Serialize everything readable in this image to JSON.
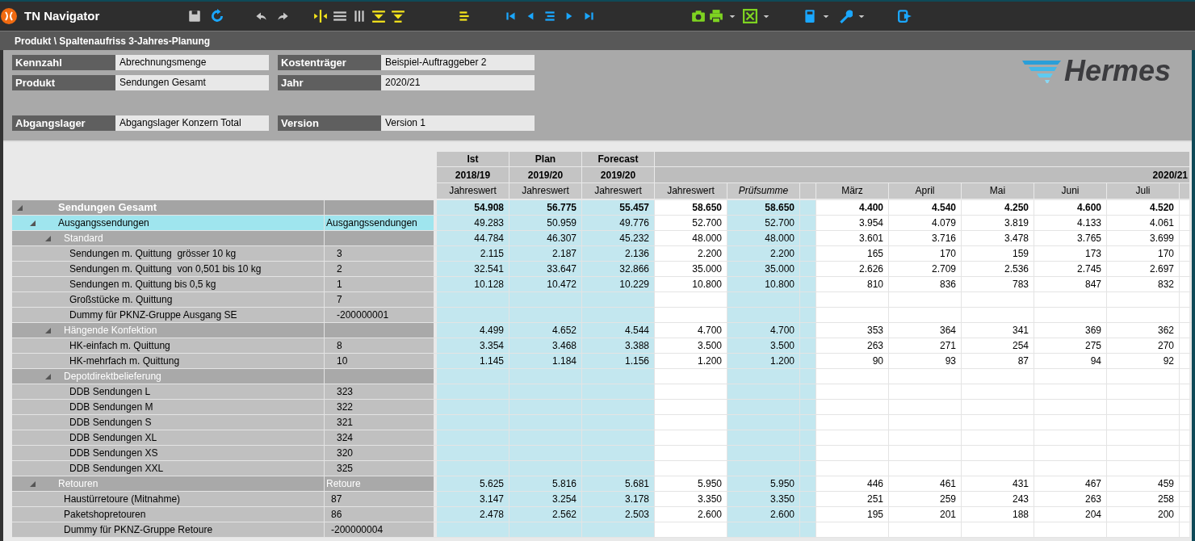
{
  "app": {
    "title": "TN Navigator"
  },
  "breadcrumb": "Produkt \\ Spaltenaufriss 3-Jahres-Planung",
  "filters": [
    [
      {
        "label": "Kennzahl",
        "value": "Abrechnungsmenge"
      },
      {
        "label": "Kostenträger",
        "value": "Beispiel-Auftraggeber 2"
      }
    ],
    [
      {
        "label": "Produkt",
        "value": "Sendungen Gesamt"
      },
      {
        "label": "Jahr",
        "value": "2020/21"
      }
    ],
    [
      {
        "label": "Abgangslager",
        "value": "Abgangslager Konzern Total"
      },
      {
        "label": "Version",
        "value": "Version 1"
      }
    ]
  ],
  "logo": {
    "text": "Hermes"
  },
  "history_columns": [
    {
      "title": "Ist",
      "year": "2018/19",
      "label": "Jahreswert"
    },
    {
      "title": "Plan",
      "year": "2019/20",
      "label": "Jahreswert"
    },
    {
      "title": "Forecast",
      "year": "2019/20",
      "label": "Jahreswert"
    }
  ],
  "plan_year": "2020/21",
  "plan_columns": [
    {
      "kind": "value",
      "label": "Jahreswert"
    },
    {
      "kind": "checksum",
      "label": "Prüfsumme"
    },
    {
      "kind": "month",
      "label": "März"
    },
    {
      "kind": "month",
      "label": "April"
    },
    {
      "kind": "month",
      "label": "Mai"
    },
    {
      "kind": "month",
      "label": "Juni"
    },
    {
      "kind": "month",
      "label": "Juli"
    }
  ],
  "tree": [
    {
      "label": "Sendungen Gesamt",
      "expanded": true,
      "selected": false,
      "values": [
        "54.908",
        "56.775",
        "55.457",
        "58.650",
        "58.650",
        "4.400",
        "4.540",
        "4.250",
        "4.600",
        "4.520"
      ],
      "children": [
        {
          "label": "Ausgangssendungen",
          "code": "Ausgangssendungen",
          "expanded": true,
          "selected": true,
          "values": [
            "49.283",
            "50.959",
            "49.776",
            "52.700",
            "52.700",
            "3.954",
            "4.079",
            "3.819",
            "4.133",
            "4.061"
          ],
          "children": [
            {
              "label": "Standard",
              "expanded": true,
              "selected": false,
              "values": [
                "44.784",
                "46.307",
                "45.232",
                "48.000",
                "48.000",
                "3.601",
                "3.716",
                "3.478",
                "3.765",
                "3.699"
              ],
              "children": [
                {
                  "label": "Sendungen m. Quittung  grösser 10 kg",
                  "code": "3",
                  "selected": false,
                  "values": [
                    "2.115",
                    "2.187",
                    "2.136",
                    "2.200",
                    "2.200",
                    "165",
                    "170",
                    "159",
                    "173",
                    "170"
                  ]
                },
                {
                  "label": "Sendungen m. Quittung  von 0,501 bis 10 kg",
                  "code": "2",
                  "selected": false,
                  "values": [
                    "32.541",
                    "33.647",
                    "32.866",
                    "35.000",
                    "35.000",
                    "2.626",
                    "2.709",
                    "2.536",
                    "2.745",
                    "2.697"
                  ]
                },
                {
                  "label": "Sendungen m. Quittung bis 0,5 kg",
                  "code": "1",
                  "selected": false,
                  "values": [
                    "10.128",
                    "10.472",
                    "10.229",
                    "10.800",
                    "10.800",
                    "810",
                    "836",
                    "783",
                    "847",
                    "832"
                  ]
                },
                {
                  "label": "Großstücke m. Quittung",
                  "code": "7",
                  "selected": false
                },
                {
                  "label": "Dummy für PKNZ-Gruppe Ausgang SE",
                  "code": "-200000001",
                  "selected": false
                }
              ]
            },
            {
              "label": "Hängende Konfektion",
              "expanded": true,
              "selected": false,
              "values": [
                "4.499",
                "4.652",
                "4.544",
                "4.700",
                "4.700",
                "353",
                "364",
                "341",
                "369",
                "362"
              ],
              "children": [
                {
                  "label": "HK-einfach m. Quittung",
                  "code": "8",
                  "selected": false,
                  "values": [
                    "3.354",
                    "3.468",
                    "3.388",
                    "3.500",
                    "3.500",
                    "263",
                    "271",
                    "254",
                    "275",
                    "270"
                  ]
                },
                {
                  "label": "HK-mehrfach m. Quittung",
                  "code": "10",
                  "selected": false,
                  "values": [
                    "1.145",
                    "1.184",
                    "1.156",
                    "1.200",
                    "1.200",
                    "90",
                    "93",
                    "87",
                    "94",
                    "92"
                  ]
                }
              ]
            },
            {
              "label": "Depotdirektbelieferung",
              "expanded": true,
              "selected": false,
              "children": [
                {
                  "label": "DDB Sendungen L",
                  "code": "323",
                  "selected": false
                },
                {
                  "label": "DDB Sendungen M",
                  "code": "322",
                  "selected": false
                },
                {
                  "label": "DDB Sendungen S",
                  "code": "321",
                  "selected": false
                },
                {
                  "label": "DDB Sendungen XL",
                  "code": "324",
                  "selected": false
                },
                {
                  "label": "DDB Sendungen XS",
                  "code": "320",
                  "selected": false
                },
                {
                  "label": "DDB Sendungen XXL",
                  "code": "325",
                  "selected": false
                }
              ]
            }
          ]
        },
        {
          "label": "Retouren",
          "code": "Retoure",
          "expanded": true,
          "selected": false,
          "values": [
            "5.625",
            "5.816",
            "5.681",
            "5.950",
            "5.950",
            "446",
            "461",
            "431",
            "467",
            "459"
          ],
          "children": [
            {
              "label": "Haustürretoure (Mitnahme)",
              "code": "87",
              "selected": false,
              "values": [
                "3.147",
                "3.254",
                "3.178",
                "3.350",
                "3.350",
                "251",
                "259",
                "243",
                "263",
                "258"
              ]
            },
            {
              "label": "Paketshopretouren",
              "code": "86",
              "selected": false,
              "values": [
                "2.478",
                "2.562",
                "2.503",
                "2.600",
                "2.600",
                "195",
                "201",
                "188",
                "204",
                "200"
              ]
            },
            {
              "label": "Dummy für PKNZ-Gruppe Retoure",
              "code": "-200000004",
              "selected": false
            }
          ]
        }
      ]
    }
  ]
}
